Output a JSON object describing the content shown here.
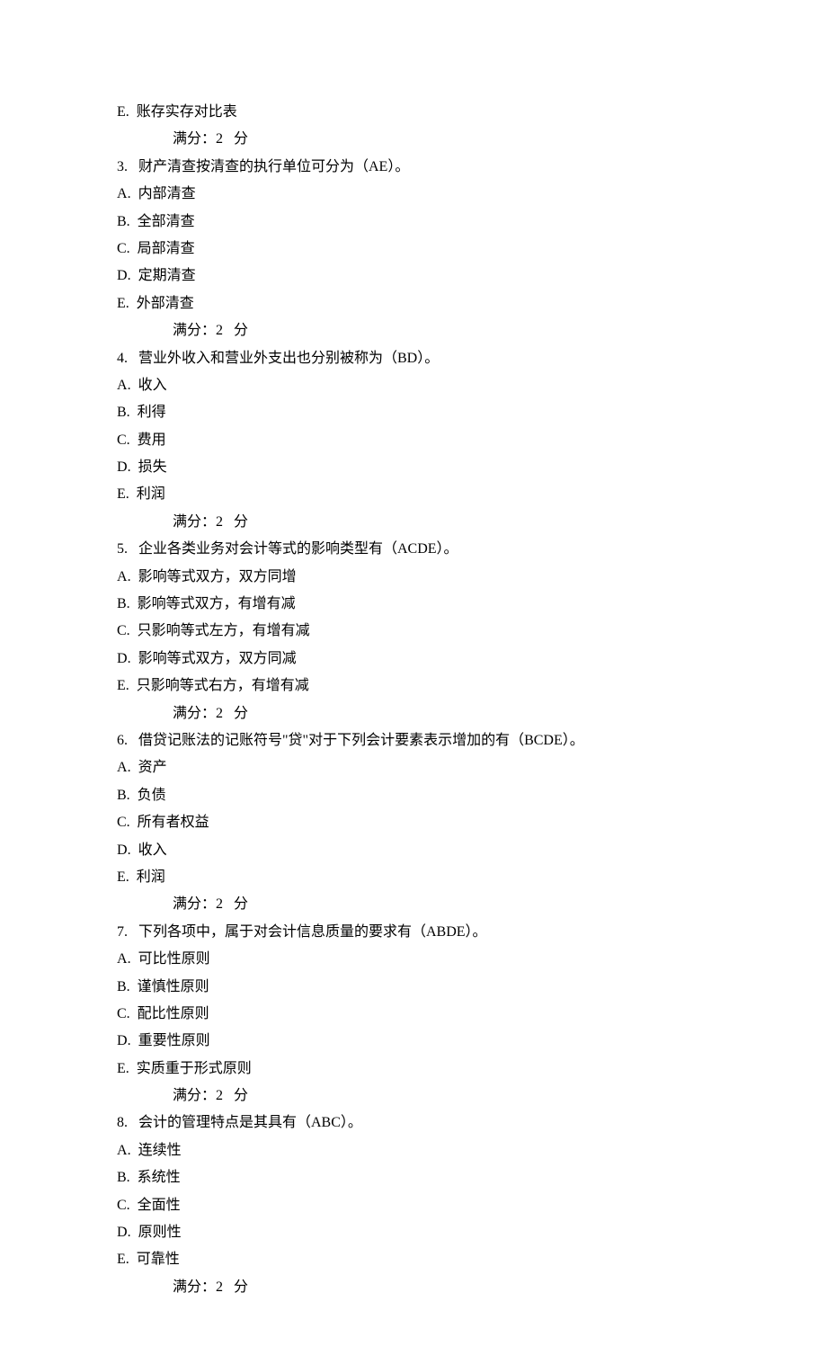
{
  "items": [
    {
      "type": "option",
      "letter": "E",
      "text": "账存实存对比表"
    },
    {
      "type": "score",
      "text": "满分：2   分"
    },
    {
      "type": "question",
      "num": "3",
      "text": "财产清查按清查的执行单位可分为（AE）。"
    },
    {
      "type": "option",
      "letter": "A",
      "text": "内部清查"
    },
    {
      "type": "option",
      "letter": "B",
      "text": "全部清查"
    },
    {
      "type": "option",
      "letter": "C",
      "text": "局部清查"
    },
    {
      "type": "option",
      "letter": "D",
      "text": "定期清查"
    },
    {
      "type": "option",
      "letter": "E",
      "text": "外部清查"
    },
    {
      "type": "score",
      "text": "满分：2   分"
    },
    {
      "type": "question",
      "num": "4",
      "text": "营业外收入和营业外支出也分别被称为（BD）。"
    },
    {
      "type": "option",
      "letter": "A",
      "text": "收入"
    },
    {
      "type": "option",
      "letter": "B",
      "text": "利得"
    },
    {
      "type": "option",
      "letter": "C",
      "text": "费用"
    },
    {
      "type": "option",
      "letter": "D",
      "text": "损失"
    },
    {
      "type": "option",
      "letter": "E",
      "text": "利润"
    },
    {
      "type": "score",
      "text": "满分：2   分"
    },
    {
      "type": "question",
      "num": "5",
      "text": "企业各类业务对会计等式的影响类型有（ACDE）。"
    },
    {
      "type": "option",
      "letter": "A",
      "text": "影响等式双方，双方同增"
    },
    {
      "type": "option",
      "letter": "B",
      "text": "影响等式双方，有增有减"
    },
    {
      "type": "option",
      "letter": "C",
      "text": "只影响等式左方，有增有减"
    },
    {
      "type": "option",
      "letter": "D",
      "text": "影响等式双方，双方同减"
    },
    {
      "type": "option",
      "letter": "E",
      "text": "只影响等式右方，有增有减"
    },
    {
      "type": "score",
      "text": "满分：2   分"
    },
    {
      "type": "question",
      "num": "6",
      "text": "借贷记账法的记账符号\"贷\"对于下列会计要素表示增加的有（BCDE）。"
    },
    {
      "type": "option",
      "letter": "A",
      "text": "资产"
    },
    {
      "type": "option",
      "letter": "B",
      "text": "负债"
    },
    {
      "type": "option",
      "letter": "C",
      "text": "所有者权益"
    },
    {
      "type": "option",
      "letter": "D",
      "text": "收入"
    },
    {
      "type": "option",
      "letter": "E",
      "text": "利润"
    },
    {
      "type": "score",
      "text": "满分：2   分"
    },
    {
      "type": "question",
      "num": "7",
      "text": "下列各项中，属于对会计信息质量的要求有（ABDE）。"
    },
    {
      "type": "option",
      "letter": "A",
      "text": "可比性原则"
    },
    {
      "type": "option",
      "letter": "B",
      "text": "谨慎性原则"
    },
    {
      "type": "option",
      "letter": "C",
      "text": "配比性原则"
    },
    {
      "type": "option",
      "letter": "D",
      "text": "重要性原则"
    },
    {
      "type": "option",
      "letter": "E",
      "text": "实质重于形式原则"
    },
    {
      "type": "score",
      "text": "满分：2   分"
    },
    {
      "type": "question",
      "num": "8",
      "text": "会计的管理特点是其具有（ABC）。"
    },
    {
      "type": "option",
      "letter": "A",
      "text": "连续性"
    },
    {
      "type": "option",
      "letter": "B",
      "text": "系统性"
    },
    {
      "type": "option",
      "letter": "C",
      "text": "全面性"
    },
    {
      "type": "option",
      "letter": "D",
      "text": "原则性"
    },
    {
      "type": "option",
      "letter": "E",
      "text": "可靠性"
    },
    {
      "type": "score",
      "text": "满分：2   分"
    }
  ]
}
